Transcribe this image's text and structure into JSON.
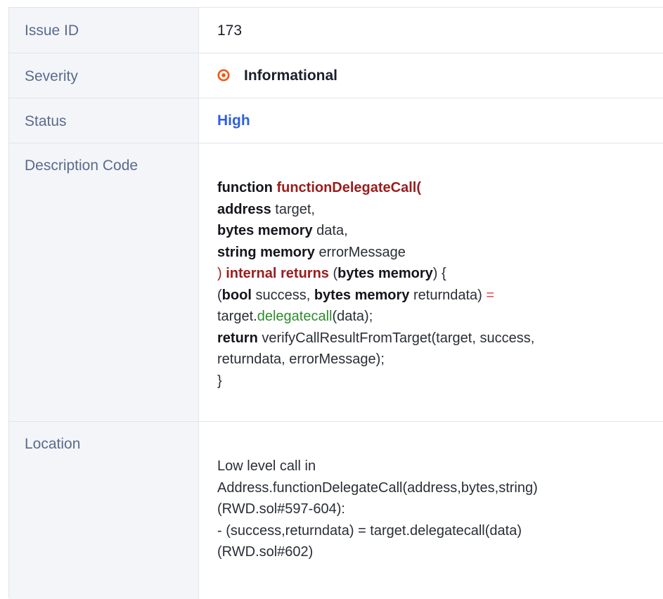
{
  "rows": {
    "issue_id": {
      "label": "Issue ID",
      "value": "173"
    },
    "severity": {
      "label": "Severity",
      "value": "Informational",
      "icon": "target-icon",
      "icon_color": "#f05a1a"
    },
    "status": {
      "label": "Status",
      "value": "High",
      "value_color": "#2f5fe0"
    },
    "description": {
      "label": "Description Code"
    },
    "location": {
      "label": "Location"
    }
  },
  "code": {
    "l1_kw": "function",
    "l1_fn": "functionDelegateCall",
    "l1_rest": "(",
    "l2_kw": "address",
    "l2_rest": " target,",
    "l3_kw": "bytes memory",
    "l3_rest": " data,",
    "l4_kw": "string memory",
    "l4_rest": " errorMessage",
    "l5_a": ") ",
    "l5_fn": "internal returns",
    "l5_b": " (",
    "l5_kw": "bytes memory",
    "l5_c": ") {",
    "l6_a": "(",
    "l6_kw1": "bool",
    "l6_b": " success, ",
    "l6_kw2": "bytes memory",
    "l6_c": " returndata) ",
    "l6_op": "=",
    "l7_a": "target.",
    "l7_grn": "delegatecall",
    "l7_b": "(data);",
    "l8_kw": "return",
    "l8_rest": " verifyCallResultFromTarget(target, success,",
    "l9": "returndata, errorMessage);",
    "l10": "}"
  },
  "location": {
    "l1": "Low level call in",
    "l2": "Address.functionDelegateCall(address,bytes,string)",
    "l3": "(RWD.sol#597-604):",
    "l4": "- (success,returndata) = target.delegatecall(data)",
    "l5": "(RWD.sol#602)"
  }
}
